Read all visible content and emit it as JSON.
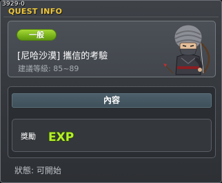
{
  "debug_id": "3929-0",
  "window": {
    "title": "QUEST INFO"
  },
  "quest": {
    "category": "一般",
    "name": "[尼哈沙漠] 攜信的考驗",
    "level_range": "建議等級: 85~89",
    "npc_icon": "hooded-npc-icon"
  },
  "content": {
    "header": "內容",
    "reward_label": "獎勵",
    "reward_icon": "exp-icon",
    "reward_text": "EXP"
  },
  "status": "狀態: 可開始",
  "colors": {
    "title": "#f0c83c",
    "badge": "#8cc426",
    "exp": "#b6f02a"
  }
}
